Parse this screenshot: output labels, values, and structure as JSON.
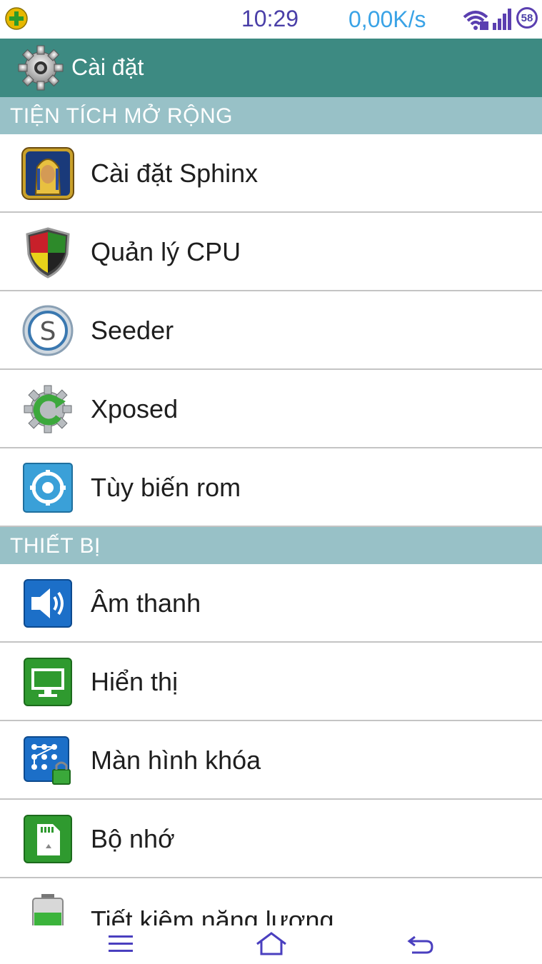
{
  "status_bar": {
    "time": "10:29",
    "net_speed": "0,00K/s",
    "battery": "58",
    "icons": [
      "add-icon",
      "wifi-icon",
      "signal-icon",
      "battery-icon"
    ]
  },
  "action_bar": {
    "title": "Cài đặt",
    "icon": "settings-gear-icon"
  },
  "sections": [
    {
      "header": "TIỆN TÍCH MỞ RỘNG",
      "items": [
        {
          "label": "Cài đặt Sphinx",
          "icon": "sphinx-icon"
        },
        {
          "label": "Quản lý CPU",
          "icon": "cpu-shield-icon"
        },
        {
          "label": "Seeder",
          "icon": "seeder-icon"
        },
        {
          "label": "Xposed",
          "icon": "xposed-icon"
        },
        {
          "label": "Tùy biến rom",
          "icon": "rom-settings-icon"
        }
      ]
    },
    {
      "header": "THIẾT BỊ",
      "items": [
        {
          "label": "Âm thanh",
          "icon": "sound-icon"
        },
        {
          "label": "Hiển thị",
          "icon": "display-icon"
        },
        {
          "label": "Màn hình khóa",
          "icon": "lockscreen-icon"
        },
        {
          "label": "Bộ nhớ",
          "icon": "storage-icon"
        },
        {
          "label": "Tiết kiệm năng lượng",
          "icon": "battery-saver-icon"
        }
      ]
    }
  ],
  "nav_bar": {
    "icons": [
      "menu-icon",
      "home-icon",
      "back-icon"
    ]
  },
  "colors": {
    "action_bar": "#3d8a82",
    "section_header": "#98c1c7",
    "status_time": "#4a3fa8",
    "status_speed": "#3aa3e6",
    "nav_icon": "#4a3fbf"
  }
}
